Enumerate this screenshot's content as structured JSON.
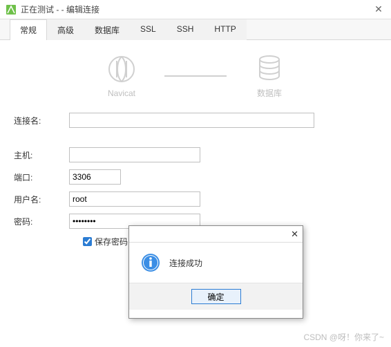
{
  "window": {
    "title_prefix": "正在测试 - ",
    "title_mid": " ",
    "title_suffix": "- 编辑连接"
  },
  "tabs": {
    "t0": "常规",
    "t1": "高级",
    "t2": "数据库",
    "t3": "SSL",
    "t4": "SSH",
    "t5": "HTTP"
  },
  "diagram": {
    "left_label": "Navicat",
    "right_label": "数据库"
  },
  "form": {
    "conn_name_label": "连接名:",
    "conn_name_value": "",
    "host_label": "主机:",
    "host_value": "",
    "port_label": "端口:",
    "port_value": "3306",
    "user_label": "用户名:",
    "user_value": "root",
    "pwd_label": "密码:",
    "pwd_value": "••••••••",
    "save_pwd_label": "保存密码"
  },
  "msgbox": {
    "text": "连接成功",
    "ok": "确定"
  },
  "watermark": "CSDN @呀！你来了~"
}
